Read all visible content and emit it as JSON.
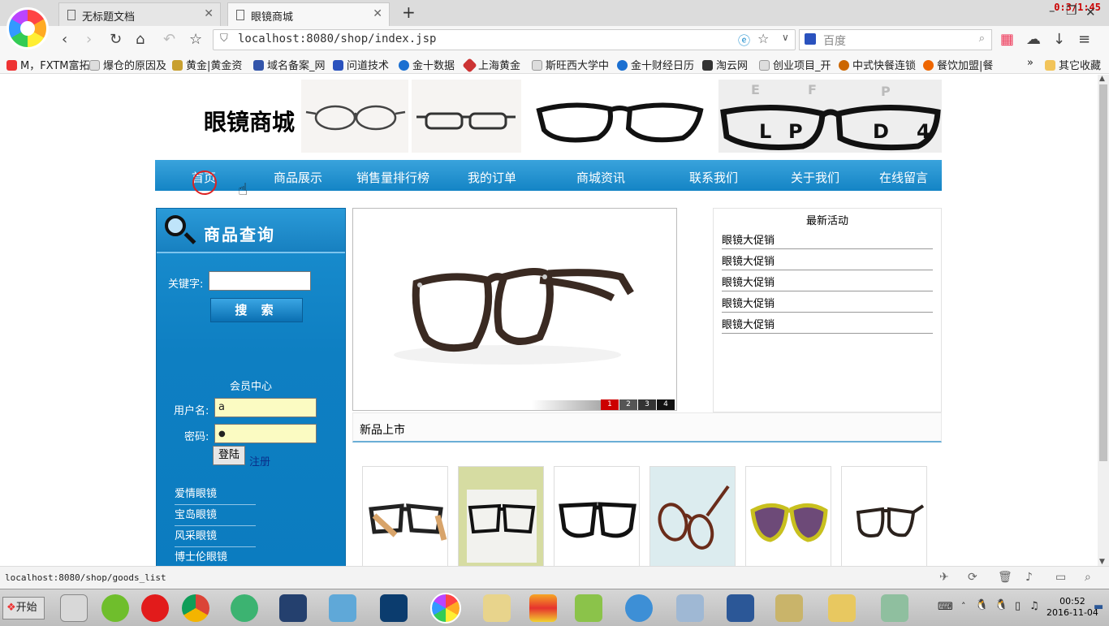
{
  "browser": {
    "tabs": [
      {
        "label": "无标题文档",
        "active": false
      },
      {
        "label": "眼镜商城",
        "active": true
      }
    ],
    "timer": "0:3/1:45",
    "url": "localhost:8080/shop/index.jsp",
    "search_placeholder": "百度",
    "bookmarks": [
      {
        "label": "M，FXTM富拓",
        "color": "#e33"
      },
      {
        "label": "爆仓的原因及",
        "color": "#bbb"
      },
      {
        "label": "黄金|黄金资",
        "color": "#c8a030"
      },
      {
        "label": "域名备案_网",
        "color": "#35a"
      },
      {
        "label": "问道技术",
        "color": "#2a52be"
      },
      {
        "label": "金十数据",
        "color": "#1a6fd1"
      },
      {
        "label": "上海黄金",
        "color": "#c33"
      },
      {
        "label": "斯旺西大学中",
        "color": "#bbb"
      },
      {
        "label": "金十财经日历",
        "color": "#1a6fd1"
      },
      {
        "label": "淘云网",
        "color": "#333"
      },
      {
        "label": "创业项目_开",
        "color": "#bbb"
      },
      {
        "label": "中式快餐连锁",
        "color": "#c60"
      },
      {
        "label": "餐饮加盟|餐",
        "color": "#e60"
      }
    ],
    "bookmarks_more": "»",
    "other_bookmarks": "其它收藏",
    "status_url": "localhost:8080/shop/goods_list"
  },
  "shop": {
    "title": "眼镜商城",
    "nav": [
      "首页",
      "商品展示",
      "销售量排行榜",
      "我的订单",
      "商城资讯",
      "联系我们",
      "关于我们",
      "在线留言"
    ],
    "search_panel_title": "商品查询",
    "keyword_label": "关键字:",
    "keyword_value": "",
    "search_button": "搜 索",
    "member_center": "会员中心",
    "username_label": "用户名:",
    "username_value": "a",
    "password_label": "密码:",
    "password_value": "●",
    "login_button": "登陆",
    "register_link": "注册",
    "categories": [
      "爱情眼镜",
      "宝岛眼镜",
      "风采眼镜",
      "博士伦眼镜"
    ],
    "slider_pages": [
      "1",
      "2",
      "3",
      "4"
    ],
    "slider_active": 1,
    "news_title": "最新活动",
    "news_items": [
      "眼镜大促销",
      "眼镜大促销",
      "眼镜大促销",
      "眼镜大促销",
      "眼镜大促销"
    ],
    "new_arrivals_title": "新品上市",
    "accent_color": "#1a8ccd"
  },
  "taskbar": {
    "start_label": "开始",
    "time": "00:52",
    "date": "2016-11-04"
  }
}
